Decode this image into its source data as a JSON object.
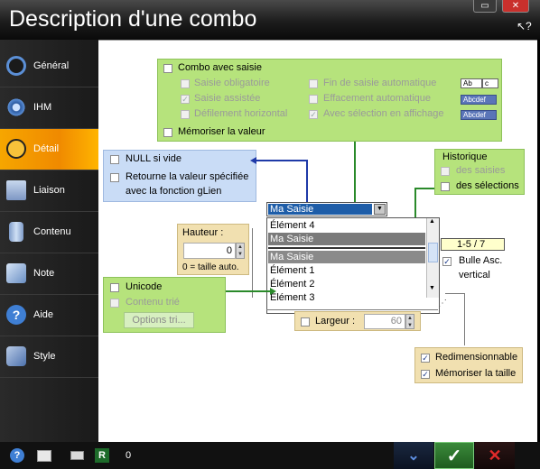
{
  "window": {
    "title": "Description d'une combo"
  },
  "sidebar": {
    "items": [
      {
        "label": "Général",
        "icon": "circle-ring-icon",
        "active": false
      },
      {
        "label": "IHM",
        "icon": "eye-icon",
        "active": false
      },
      {
        "label": "Détail",
        "icon": "magnifier-icon",
        "active": true
      },
      {
        "label": "Liaison",
        "icon": "database-icon",
        "active": false
      },
      {
        "label": "Contenu",
        "icon": "cylinder-icon",
        "active": false
      },
      {
        "label": "Note",
        "icon": "notebook-icon",
        "active": false
      },
      {
        "label": "Aide",
        "icon": "help-icon",
        "active": false
      },
      {
        "label": "Style",
        "icon": "style-icon",
        "active": false
      }
    ]
  },
  "combo_group": {
    "main_label": "Combo avec saisie",
    "options_left": [
      "Saisie obligatoire",
      "Saisie assistée",
      "Défilement horizontal"
    ],
    "options_right": [
      "Fin de saisie automatique",
      "Effacement automatique",
      "Avec sélection en affichage"
    ],
    "samples": [
      "Ab",
      "c",
      "Abcdef",
      "Abcdef"
    ],
    "memo_label": "Mémoriser la valeur"
  },
  "null_group": {
    "null_label": "NULL si vide",
    "return_label_1": "Retourne la valeur spécifiée",
    "return_label_2": "avec la fonction gLien"
  },
  "history_group": {
    "title": "Historique",
    "opt1": "des saisies",
    "opt2": "des sélections"
  },
  "combo_preview": {
    "value": "Ma Saisie",
    "history_items": [
      "Élément 4",
      "Ma Saisie"
    ],
    "list_items": [
      "Ma Saisie",
      "Élément 1",
      "Élément 2",
      "Élément 3"
    ]
  },
  "height_group": {
    "label": "Hauteur :",
    "value": "0",
    "hint": "0 = taille auto."
  },
  "bubble": {
    "counter": "1-5 / 7",
    "label_1": "Bulle Asc.",
    "label_2": "vertical"
  },
  "unicode_group": {
    "unicode_label": "Unicode",
    "sorted_label": "Contenu trié",
    "sort_button": "Options tri..."
  },
  "width_group": {
    "label": "Largeur :",
    "value": "60"
  },
  "resize_group": {
    "opt1": "Redimensionnable",
    "opt2": "Mémoriser la taille"
  },
  "bottom": {
    "counter": "0"
  }
}
